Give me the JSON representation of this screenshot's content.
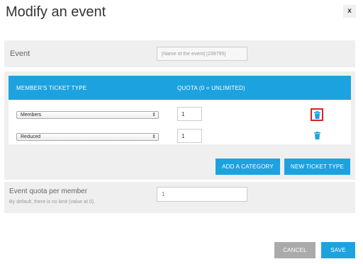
{
  "modal": {
    "title": "Modify an event",
    "close_label": "x"
  },
  "event": {
    "label": "Event",
    "value": "[Name of the event] [239795]"
  },
  "tickets": {
    "headers": {
      "type": "MEMBER'S TICKET TYPE",
      "quota": "QUOTA (0 = UNLIMITED)"
    },
    "rows": [
      {
        "type": "Members",
        "quota": "1",
        "delete_icon": "trash-icon",
        "highlighted": true
      },
      {
        "type": "Reduced",
        "quota": "1",
        "delete_icon": "trash-icon",
        "highlighted": false
      }
    ],
    "add_category_label": "ADD A CATEGORY",
    "new_ticket_type_label": "NEW TICKET TYPE"
  },
  "event_quota": {
    "label": "Event quota per member",
    "help": "By default, there is no limit (value at 0).",
    "placeholder": "1"
  },
  "footer": {
    "cancel_label": "CANCEL",
    "save_label": "SAVE"
  },
  "colors": {
    "accent": "#1da2e0",
    "panel": "#efefef",
    "highlight": "#e02020",
    "cancel": "#aaaaaa"
  }
}
